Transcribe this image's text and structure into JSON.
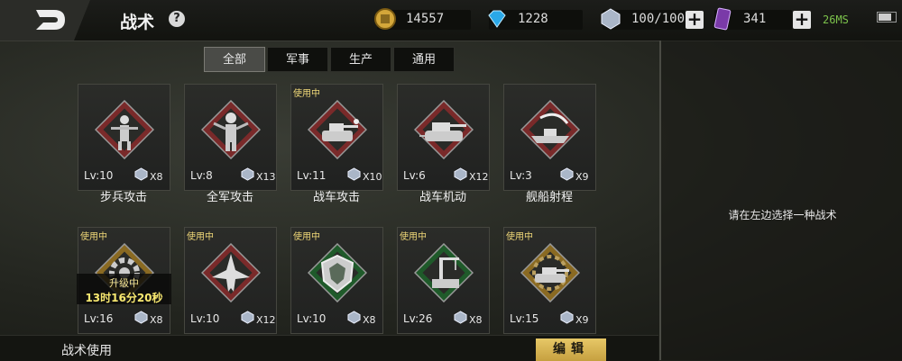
{
  "header": {
    "title": "战术",
    "help_label": "?",
    "back_icon": "back-d-icon"
  },
  "resources": {
    "gold": {
      "value": "14557",
      "icon": "gold-coin-icon"
    },
    "diamond": {
      "value": "1228",
      "icon": "diamond-icon"
    },
    "energy": {
      "value": "100/100",
      "icon": "crystal-icon"
    },
    "card": {
      "value": "341",
      "icon": "purple-card-icon"
    },
    "plus_label": "+",
    "ping": "26MS"
  },
  "tabs": [
    {
      "label": "全部",
      "active": true
    },
    {
      "label": "军事",
      "active": false
    },
    {
      "label": "生产",
      "active": false
    },
    {
      "label": "通用",
      "active": false
    }
  ],
  "cards": [
    {
      "name": "步兵攻击",
      "level": "Lv:10",
      "qty": "X8",
      "badge": "",
      "frame": "red",
      "icon": "infantry-icon"
    },
    {
      "name": "全军攻击",
      "level": "Lv:8",
      "qty": "X13",
      "badge": "",
      "frame": "red",
      "icon": "soldier-icon"
    },
    {
      "name": "战车攻击",
      "level": "Lv:11",
      "qty": "X10",
      "badge": "使用中",
      "frame": "red",
      "icon": "tank-attack-icon"
    },
    {
      "name": "战车机动",
      "level": "Lv:6",
      "qty": "X12",
      "badge": "",
      "frame": "red",
      "icon": "tank-move-icon"
    },
    {
      "name": "舰船射程",
      "level": "Lv:3",
      "qty": "X9",
      "badge": "",
      "frame": "red",
      "icon": "ship-icon"
    },
    {
      "name": "",
      "level": "Lv:16",
      "qty": "X8",
      "badge": "使用中",
      "frame": "gold",
      "icon": "gear-icon",
      "upgrade": {
        "line1": "升级中",
        "line2": "13时16分20秒"
      }
    },
    {
      "name": "",
      "level": "Lv:10",
      "qty": "X12",
      "badge": "使用中",
      "frame": "red",
      "icon": "jet-icon"
    },
    {
      "name": "",
      "level": "Lv:10",
      "qty": "X8",
      "badge": "使用中",
      "frame": "green",
      "icon": "shield-icon"
    },
    {
      "name": "",
      "level": "Lv:26",
      "qty": "X8",
      "badge": "使用中",
      "frame": "green",
      "icon": "crane-icon"
    },
    {
      "name": "",
      "level": "Lv:15",
      "qty": "X9",
      "badge": "使用中",
      "frame": "gold",
      "icon": "gear-tank-icon"
    }
  ],
  "right_panel": {
    "hint": "请在左边选择一种战术"
  },
  "bottom": {
    "label": "战术使用",
    "edit_label": "编辑"
  },
  "colors": {
    "red_frame": "#7a2a2a",
    "gold_frame": "#8a6a22",
    "green_frame": "#1f5a2a",
    "accent": "#e0c060"
  }
}
